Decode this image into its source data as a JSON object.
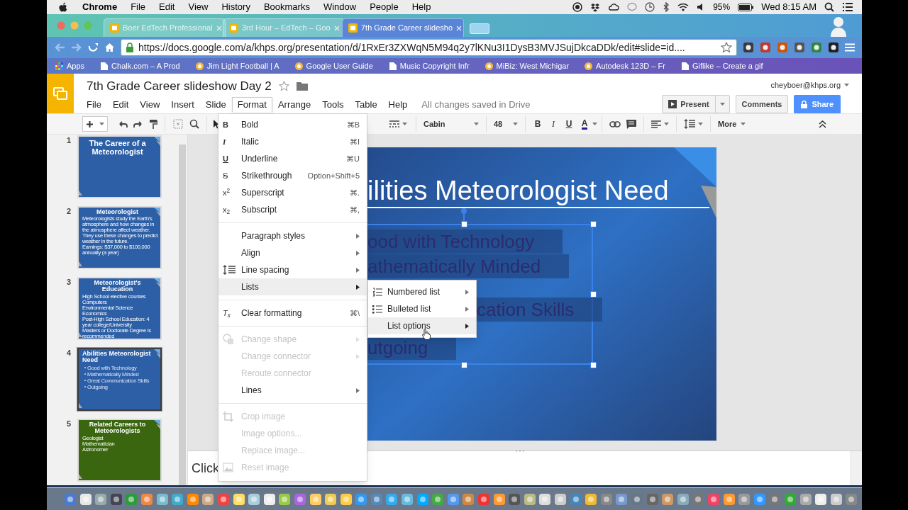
{
  "menubar": {
    "app": "Chrome",
    "menus": [
      "File",
      "Edit",
      "View",
      "History",
      "Bookmarks",
      "Window",
      "People",
      "Help"
    ],
    "battery": "95%",
    "clock": "Wed 8:15 AM"
  },
  "tabs": [
    {
      "title": "Boer EdTech Professional",
      "selected": false
    },
    {
      "title": "3rd Hour – EdTech – Goo",
      "selected": false
    },
    {
      "title": "7th Grade Career slidesho",
      "selected": true
    }
  ],
  "address": {
    "url": "https://docs.google.com/a/khps.org/presentation/d/1RxEr3ZXWqN5M94q2y7lKNu3I1DysB3MVJSujDkcaDDk/edit#slide=id...."
  },
  "bookmarks": [
    {
      "label": "Apps",
      "kind": "apps"
    },
    {
      "label": "Chalk.com – A Prod",
      "kind": "page"
    },
    {
      "label": "Jim Light Football | A",
      "kind": "site"
    },
    {
      "label": "Google User Guide",
      "kind": "site"
    },
    {
      "label": "Music Copyright Infr",
      "kind": "page"
    },
    {
      "label": "MiBiz: West Michigar",
      "kind": "site"
    },
    {
      "label": "Autodesk 123D – Fr",
      "kind": "site"
    },
    {
      "label": "Giflike – Create a gif",
      "kind": "page"
    }
  ],
  "doc": {
    "title": "7th Grade Career slideshow Day 2",
    "account": "cheyboer@khps.org",
    "save_status": "All changes saved in Drive",
    "menus": [
      {
        "label": "File",
        "selected": false
      },
      {
        "label": "Edit",
        "selected": false
      },
      {
        "label": "View",
        "selected": false
      },
      {
        "label": "Insert",
        "selected": false
      },
      {
        "label": "Slide",
        "selected": false
      },
      {
        "label": "Format",
        "selected": true
      },
      {
        "label": "Arrange",
        "selected": false
      },
      {
        "label": "Tools",
        "selected": false
      },
      {
        "label": "Table",
        "selected": false
      },
      {
        "label": "Help",
        "selected": false
      }
    ],
    "present": "Present",
    "comments": "Comments",
    "share": "Share"
  },
  "toolbar": {
    "font": "Cabin",
    "font_size": "48",
    "format_buttons": [
      "B",
      "I",
      "U",
      "A"
    ],
    "more": "More"
  },
  "slides": [
    {
      "number": "1",
      "title": "The Career of a Meteorologist",
      "kind": "text",
      "selected": false,
      "color": "#2d5fa6"
    },
    {
      "number": "2",
      "title": "Meteorologist",
      "kind": "text",
      "body": [
        "Meteorologists study the Earth's atmosphere and how changes in the atmosphere affect weather. They use these changes to predict weather in the future.",
        "Earnings: $37,000 to $100,000 annually (a year)"
      ],
      "selected": false,
      "color": "#2d5fa6"
    },
    {
      "number": "3",
      "title": "Meteorologist's Education",
      "kind": "text",
      "body": [
        "High School elective courses",
        "Computers",
        "Environmental Science",
        "Economics",
        "Post-High School Education: 4 year college/University",
        "Masters or Doctorate Degree is recommended"
      ],
      "selected": false,
      "color": "#2d5fa6"
    },
    {
      "number": "4",
      "title": "Abilities Meteorologist Need",
      "kind": "bullets",
      "body": [
        "Good with Technology",
        "Mathematically Minded",
        "Great Communication Skills",
        "Outgoing"
      ],
      "selected": true,
      "color": "#2d5fa6"
    },
    {
      "number": "5",
      "title": "Related Careers to Meteorologists",
      "kind": "text",
      "body": [
        "Geologist",
        "Mathematician",
        "Astronomer"
      ],
      "selected": false,
      "color": "#3a660f"
    }
  ],
  "canvas": {
    "title": "ilities Meteorologist Need",
    "bullets": [
      "ood with Technology",
      "athematically Minded",
      "cation Skills",
      "utgoing"
    ]
  },
  "notes": {
    "text": "Click"
  },
  "format_menu": {
    "items": [
      {
        "kind": "item",
        "icon_text": "B",
        "label": "Bold",
        "shortcut": "⌘B",
        "submenu": false,
        "disabled": false,
        "selected": false
      },
      {
        "kind": "item",
        "icon_text": "I",
        "label": "Italic",
        "shortcut": "⌘I",
        "submenu": false,
        "disabled": false,
        "selected": false
      },
      {
        "kind": "item",
        "icon_text": "U",
        "label": "Underline",
        "shortcut": "⌘U",
        "submenu": false,
        "disabled": false,
        "selected": false
      },
      {
        "kind": "item",
        "icon_text": "S",
        "label": "Strikethrough",
        "shortcut": "Option+Shift+5",
        "submenu": false,
        "disabled": false,
        "selected": false
      },
      {
        "kind": "item",
        "icon_text": "x$^{2}$",
        "label": "Superscript",
        "shortcut": "⌘.",
        "submenu": false,
        "disabled": false,
        "selected": false
      },
      {
        "kind": "item",
        "icon_text": "x$_{2}$",
        "label": "Subscript",
        "shortcut": "⌘,",
        "submenu": false,
        "disabled": false,
        "selected": false
      },
      {
        "kind": "separator"
      },
      {
        "kind": "item",
        "label": "Paragraph styles",
        "submenu": true,
        "disabled": false,
        "selected": false
      },
      {
        "kind": "item",
        "label": "Align",
        "submenu": true,
        "disabled": false,
        "selected": false
      },
      {
        "kind": "item",
        "label": "Line spacing",
        "submenu": true,
        "disabled": false,
        "selected": false
      },
      {
        "kind": "item",
        "label": "Lists",
        "submenu": true,
        "disabled": false,
        "selected": true
      },
      {
        "kind": "separator"
      },
      {
        "kind": "item",
        "icon_text": "T$_{x}$",
        "label": "Clear formatting",
        "shortcut": "⌘\\",
        "submenu": false,
        "disabled": false,
        "selected": false
      },
      {
        "kind": "separator"
      },
      {
        "kind": "item",
        "label": "Change shape",
        "submenu": true,
        "disabled": true,
        "selected": false
      },
      {
        "kind": "item",
        "label": "Change connector",
        "submenu": true,
        "disabled": true,
        "selected": false
      },
      {
        "kind": "item",
        "label": "Reroute connector",
        "submenu": false,
        "disabled": true,
        "selected": false
      },
      {
        "kind": "item",
        "label": "Lines",
        "submenu": true,
        "disabled": false,
        "selected": false
      },
      {
        "kind": "separator"
      },
      {
        "kind": "item",
        "label": "Crop image",
        "submenu": false,
        "disabled": true,
        "selected": false
      },
      {
        "kind": "item",
        "label": "Image options...",
        "submenu": false,
        "disabled": true,
        "selected": false
      },
      {
        "kind": "item",
        "label": "Replace image...",
        "submenu": false,
        "disabled": true,
        "selected": false
      },
      {
        "kind": "item",
        "label": "Reset image",
        "submenu": false,
        "disabled": true,
        "selected": false
      }
    ]
  },
  "lists_submenu": {
    "items": [
      {
        "label": "Numbered list",
        "selected": false
      },
      {
        "label": "Bulleted list",
        "selected": false
      },
      {
        "label": "List options",
        "selected": true
      }
    ]
  }
}
